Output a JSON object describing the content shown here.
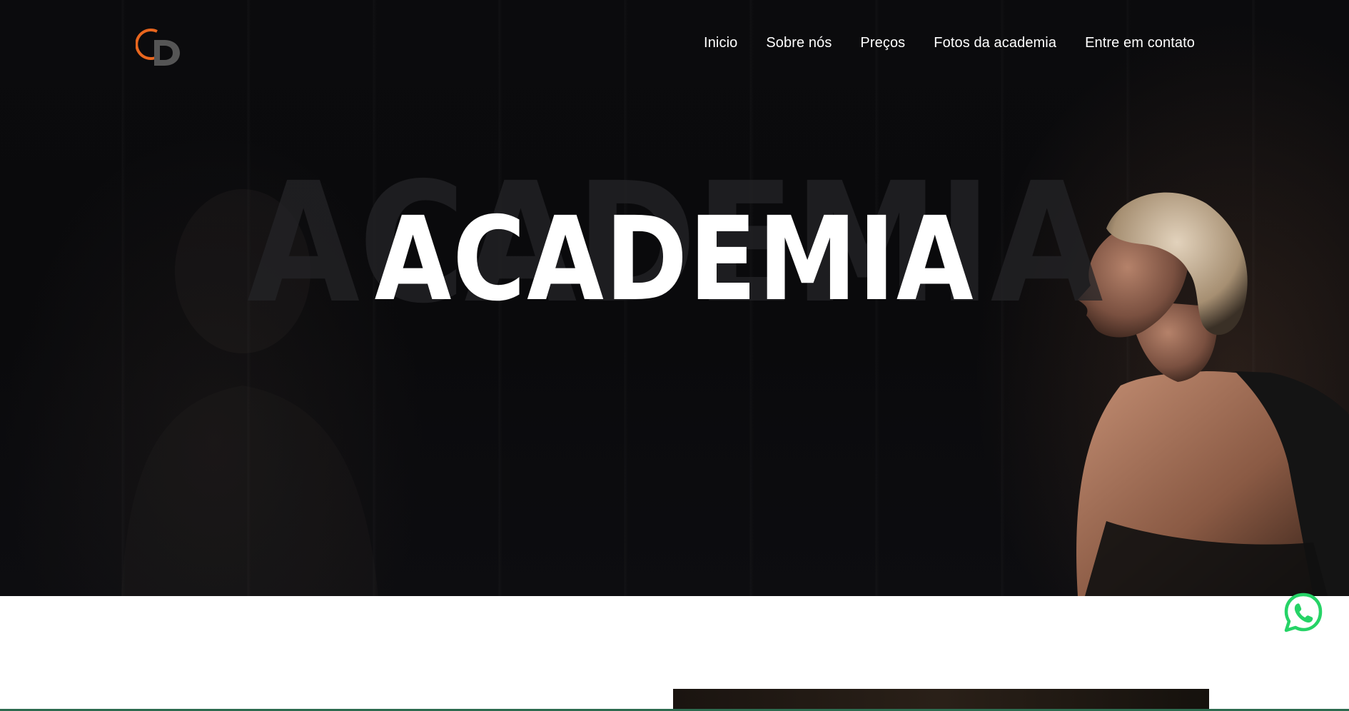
{
  "nav": {
    "items": [
      {
        "label": "Inicio"
      },
      {
        "label": "Sobre nós"
      },
      {
        "label": "Preços"
      },
      {
        "label": "Fotos da academia"
      },
      {
        "label": "Entre em contato"
      }
    ]
  },
  "hero": {
    "title": "ACADEMIA",
    "title_ghost": "ACADEMIA"
  },
  "logo": {
    "letters": "CD",
    "accent_color": "#e8661e",
    "secondary_color": "#555555"
  },
  "colors": {
    "whatsapp": "#25d366",
    "hero_background": "#0a0a0c"
  },
  "icons": {
    "floating_button": "whatsapp-icon"
  }
}
